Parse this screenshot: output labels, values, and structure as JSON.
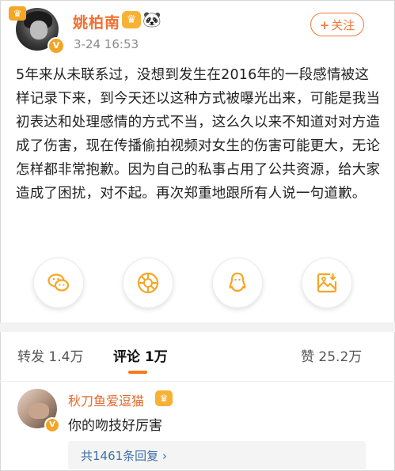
{
  "post": {
    "author": "姚柏南",
    "timestamp": "3-24 16:53",
    "follow_label": "关注",
    "follow_icon": "plus-icon",
    "content": "5年来从未联系过，没想到发生在2016年的一段感情被这样记录下来，到今天还以这种方式被曝光出来，可能是我当初表达和处理感情的方式不当，这么久以来不知道对对方造成了伤害，现在传播偷拍视频对女生的伤害可能更大，无论怎样都非常抱歉。因为自己的私事占用了公共资源，给大家造成了困扰，对不起。再次郑重地跟所有人说一句道歉。"
  },
  "share": [
    {
      "icon": "wechat-icon",
      "color": "#f5a623"
    },
    {
      "icon": "moments-icon",
      "color": "#f5a623"
    },
    {
      "icon": "qq-icon",
      "color": "#f5a623"
    },
    {
      "icon": "save-image-icon",
      "color": "#f5a623"
    }
  ],
  "stats": {
    "repost_label": "转发",
    "repost_count": "1.4万",
    "comment_label": "评论",
    "comment_count": "1万",
    "like_label": "赞",
    "like_count": "25.2万"
  },
  "comment": {
    "author": "秋刀鱼爱逗猫",
    "text": "你的吻技好厉害",
    "reply_summary": "共1461条回复",
    "reply_arrow": "›"
  },
  "colors": {
    "accent": "#f07a3c",
    "link": "#3d70a9"
  }
}
